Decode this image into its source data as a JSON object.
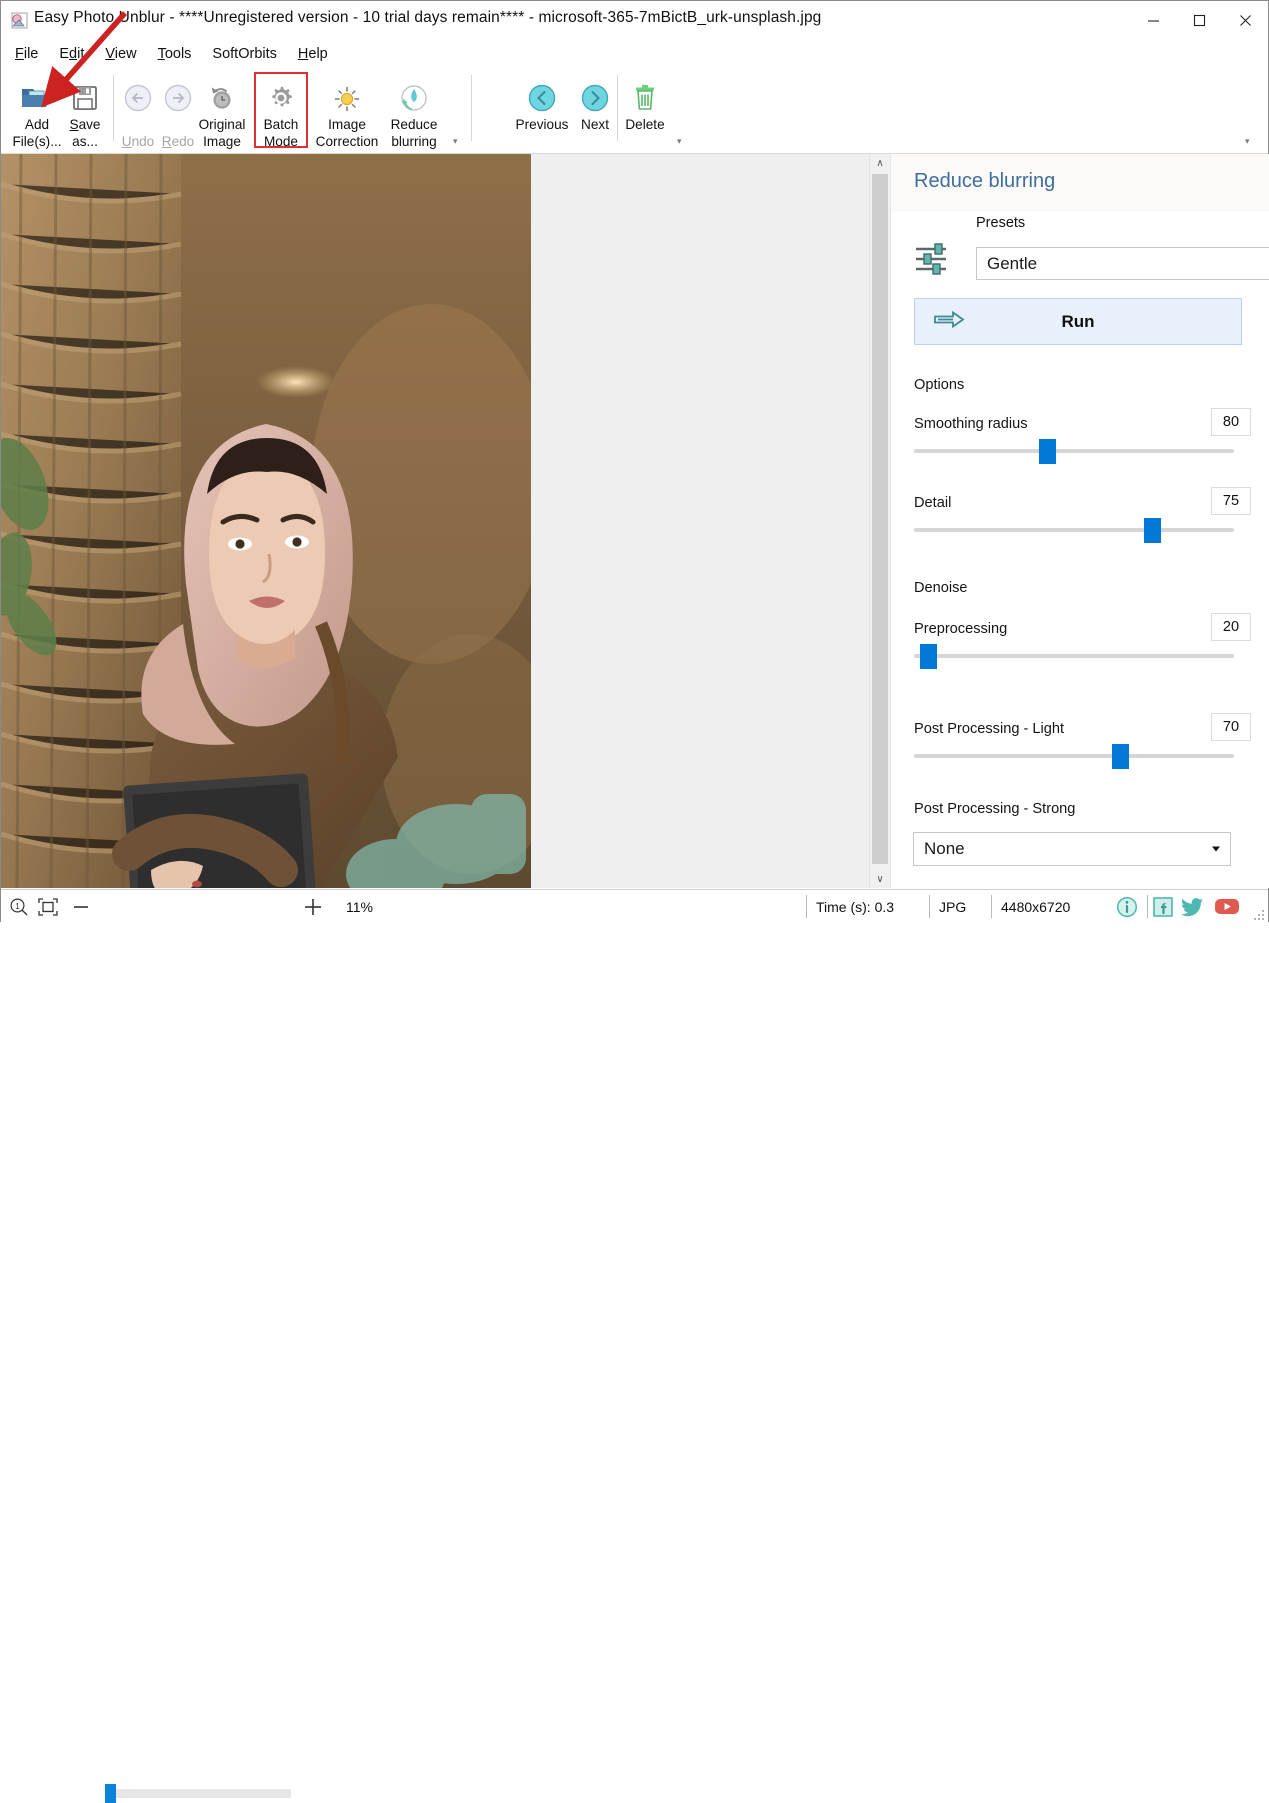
{
  "window": {
    "title": "Easy Photo Unblur - ****Unregistered version - 10 trial days remain**** - microsoft-365-7mBictB_urk-unsplash.jpg",
    "app_icon": "photo-app-icon",
    "minimize_label": "—",
    "maximize_label": "□",
    "close_label": "✕"
  },
  "menubar": {
    "items": [
      {
        "label": "File",
        "accel": "F"
      },
      {
        "label": "Edit",
        "accel": "E"
      },
      {
        "label": "View",
        "accel": "V"
      },
      {
        "label": "Tools",
        "accel": "T"
      },
      {
        "label": "SoftOrbits",
        "accel": ""
      },
      {
        "label": "Help",
        "accel": "H"
      }
    ]
  },
  "toolbar": {
    "buttons": [
      {
        "name": "add-files",
        "label": "Add\nFile(s)...",
        "icon": "open-folder-icon",
        "enabled": true,
        "highlighted": false
      },
      {
        "name": "save-as",
        "label": "Save\nas...",
        "icon": "floppy-disk-icon",
        "enabled": true,
        "highlighted": false
      },
      {
        "name": "undo",
        "label": "Undo",
        "icon": "undo-arrow-icon",
        "enabled": false,
        "highlighted": false
      },
      {
        "name": "redo",
        "label": "Redo",
        "icon": "redo-arrow-icon",
        "enabled": false,
        "highlighted": false
      },
      {
        "name": "original-image",
        "label": "Original\nImage",
        "icon": "clock-revert-icon",
        "enabled": true,
        "highlighted": false
      },
      {
        "name": "batch-mode",
        "label": "Batch\nMode",
        "icon": "gear-icon",
        "enabled": true,
        "highlighted": true
      },
      {
        "name": "image-correction",
        "label": "Image\nCorrection",
        "icon": "sun-brightness-icon",
        "enabled": true,
        "highlighted": false
      },
      {
        "name": "reduce-blurring",
        "label": "Reduce\nblurring",
        "icon": "droplet-refresh-icon",
        "enabled": true,
        "highlighted": false
      },
      {
        "name": "previous",
        "label": "Previous",
        "icon": "chevron-left-circle-icon",
        "enabled": true,
        "highlighted": false
      },
      {
        "name": "next",
        "label": "Next",
        "icon": "chevron-right-circle-icon",
        "enabled": true,
        "highlighted": false
      },
      {
        "name": "delete",
        "label": "Delete",
        "icon": "trash-can-icon",
        "enabled": true,
        "highlighted": false
      }
    ],
    "expander_glyph": "▾",
    "highlight_color": "#e03030"
  },
  "annotation": {
    "arrow_color": "#cc2222",
    "points_to": "add-files"
  },
  "panel": {
    "title": "Reduce blurring",
    "title_color": "#3d6e9e",
    "presets_label": "Presets",
    "presets_icon": "sliders-icon",
    "preset_value": "Gentle",
    "run_label": "Run",
    "run_icon": "double-arrow-right-icon",
    "options_label": "Options",
    "denoise_label": "Denoise",
    "sliders": [
      {
        "name": "smoothing-radius",
        "label": "Smoothing radius",
        "value": "80",
        "percent": 40
      },
      {
        "name": "detail",
        "label": "Detail",
        "value": "75",
        "percent": 73
      },
      {
        "name": "preprocessing",
        "label": "Preprocessing",
        "value": "20",
        "percent": 4
      },
      {
        "name": "post-processing-light",
        "label": "Post Processing - Light",
        "value": "70",
        "percent": 60
      }
    ],
    "post_processing_strong_label": "Post Processing - Strong",
    "post_processing_strong_value": "None",
    "accent_color": "#0078d7"
  },
  "canvas": {
    "scroll_up_glyph": "∧",
    "scroll_down_glyph": "∨",
    "background_color": "#efefef"
  },
  "statusbar": {
    "zoom_icon": "magnifier-1to1-icon",
    "fit_icon": "fit-to-window-icon",
    "zoom_out_label": "—",
    "zoom_in_label": "+",
    "zoom_value": "11%",
    "zoom_percent": 6,
    "time_label": "Time (s): 0.3",
    "format_label": "JPG",
    "dimensions_label": "4480x6720",
    "social": [
      {
        "name": "info-icon",
        "label": "i"
      },
      {
        "name": "facebook-icon",
        "label": "f"
      },
      {
        "name": "twitter-icon",
        "label": "t"
      },
      {
        "name": "youtube-icon",
        "label": "▶"
      }
    ]
  }
}
